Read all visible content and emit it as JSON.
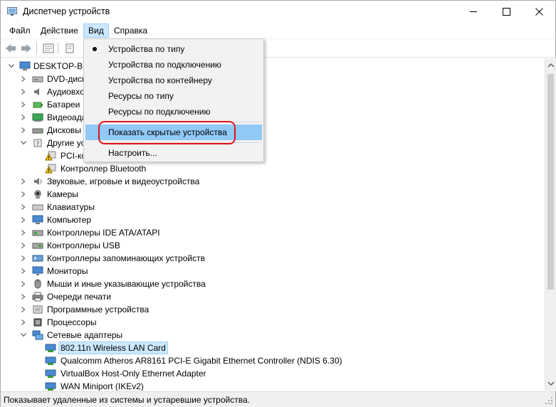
{
  "window": {
    "title": "Диспетчер устройств"
  },
  "menu": {
    "file": "Файл",
    "action": "Действие",
    "view": "Вид",
    "help": "Справка"
  },
  "view_menu": {
    "items": [
      {
        "label": "Устройства по типу",
        "checked": true
      },
      {
        "label": "Устройства по подключению"
      },
      {
        "label": "Устройства по контейнеру"
      },
      {
        "label": "Ресурсы по типу"
      },
      {
        "label": "Ресурсы по подключению"
      },
      {
        "label": "Показать скрытые устройства",
        "highlighted": true
      },
      {
        "label": "Настроить..."
      }
    ]
  },
  "tree": {
    "root": "DESKTOP-BPI",
    "items": [
      {
        "label": "DVD-дисков",
        "icon": "dvd-icon"
      },
      {
        "label": "Аудиовхо",
        "icon": "audio-icon"
      },
      {
        "label": "Батареи",
        "icon": "battery-icon"
      },
      {
        "label": "Видеоада",
        "icon": "display-adapter-icon"
      },
      {
        "label": "Дисковы",
        "icon": "disk-icon"
      },
      {
        "label": "Другие ус",
        "icon": "other-devices-icon"
      },
      {
        "label": "PCI-ко",
        "icon": "warning-device-icon"
      },
      {
        "label": "Контроллер Bluetooth",
        "icon": "warning-device-icon"
      },
      {
        "label": "Звуковые, игровые и видеоустройства",
        "icon": "sound-icon"
      },
      {
        "label": "Камеры",
        "icon": "camera-icon"
      },
      {
        "label": "Клавиатуры",
        "icon": "keyboard-icon"
      },
      {
        "label": "Компьютер",
        "icon": "computer-icon"
      },
      {
        "label": "Контроллеры IDE ATA/ATAPI",
        "icon": "ide-icon"
      },
      {
        "label": "Контроллеры USB",
        "icon": "usb-icon"
      },
      {
        "label": "Контроллеры запоминающих устройств",
        "icon": "storage-icon"
      },
      {
        "label": "Мониторы",
        "icon": "monitor-icon"
      },
      {
        "label": "Мыши и иные указывающие устройства",
        "icon": "mouse-icon"
      },
      {
        "label": "Очереди печати",
        "icon": "printer-icon"
      },
      {
        "label": "Программные устройства",
        "icon": "software-device-icon"
      },
      {
        "label": "Процессоры",
        "icon": "cpu-icon"
      },
      {
        "label": "Сетевые адаптеры",
        "icon": "network-icon"
      },
      {
        "label": "802.11n Wireless LAN Card",
        "icon": "network-adapter-icon"
      },
      {
        "label": "Qualcomm Atheros AR8161 PCI-E Gigabit Ethernet Controller (NDIS 6.30)",
        "icon": "network-adapter-icon"
      },
      {
        "label": "VirtualBox Host-Only Ethernet Adapter",
        "icon": "network-adapter-icon"
      },
      {
        "label": "WAN Miniport (IKEv2)",
        "icon": "network-adapter-icon"
      }
    ]
  },
  "status": {
    "text": "Показывает удаленные из системы и устаревшие устройства."
  },
  "colors": {
    "highlight": "#91c9f7",
    "selection": "#cce8ff",
    "ring": "#e3121b"
  }
}
